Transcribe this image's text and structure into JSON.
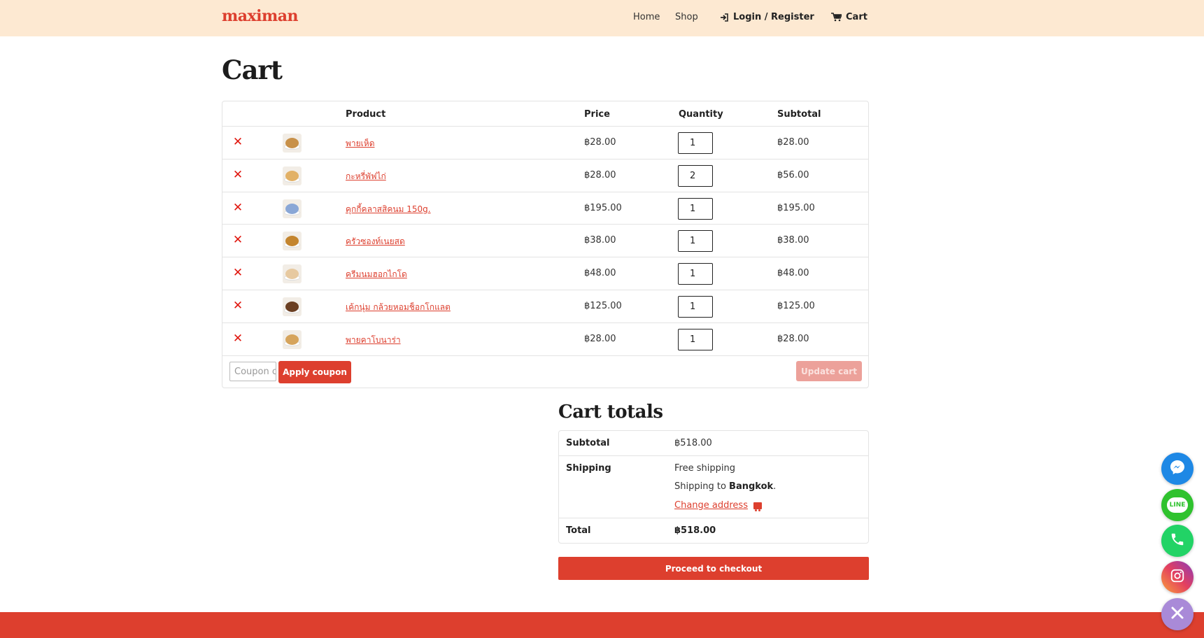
{
  "header": {
    "brand": "maximan",
    "nav": {
      "home": "Home",
      "shop": "Shop",
      "login": "Login / Register",
      "cart": "Cart"
    }
  },
  "page": {
    "title": "Cart"
  },
  "cart_table": {
    "columns": {
      "product": "Product",
      "price": "Price",
      "quantity": "Quantity",
      "subtotal": "Subtotal"
    },
    "rows": [
      {
        "name": "พายเห็ด",
        "price": "฿28.00",
        "quantity": "1",
        "subtotal": "฿28.00",
        "thumb_color": "#c8914a"
      },
      {
        "name": "กะหรี่พัฟไก่",
        "price": "฿28.00",
        "quantity": "2",
        "subtotal": "฿56.00",
        "thumb_color": "#e2b166"
      },
      {
        "name": "คุกกี้คลาสสิคนม 150g.",
        "price": "฿195.00",
        "quantity": "1",
        "subtotal": "฿195.00",
        "thumb_color": "#8aa7d6"
      },
      {
        "name": "ครัวซองท์เนยสด",
        "price": "฿38.00",
        "quantity": "1",
        "subtotal": "฿38.00",
        "thumb_color": "#c4852e"
      },
      {
        "name": "ครีมนมฮอกไกโด",
        "price": "฿48.00",
        "quantity": "1",
        "subtotal": "฿48.00",
        "thumb_color": "#e7c9a0"
      },
      {
        "name": "เค้กนุ่ม กล้วยหอมช็อกโกแลต",
        "price": "฿125.00",
        "quantity": "1",
        "subtotal": "฿125.00",
        "thumb_color": "#6b3f22"
      },
      {
        "name": "พายคาโบนาร่า",
        "price": "฿28.00",
        "quantity": "1",
        "subtotal": "฿28.00",
        "thumb_color": "#d6a45c"
      }
    ],
    "coupon_placeholder": "Coupon code",
    "apply_coupon": "Apply coupon",
    "update_cart": "Update cart"
  },
  "totals": {
    "title": "Cart totals",
    "subtotal_label": "Subtotal",
    "subtotal_value": "฿518.00",
    "shipping_label": "Shipping",
    "shipping_method": "Free shipping",
    "shipping_to_prefix": "Shipping to ",
    "shipping_to_place": "Bangkok",
    "shipping_to_suffix": ".",
    "change_address": "Change address",
    "total_label": "Total",
    "total_value": "฿518.00",
    "checkout": "Proceed to checkout"
  },
  "colors": {
    "accent": "#dd3f2e",
    "header_bg": "#fde9d2",
    "messenger": "#1e88e5",
    "line": "#2fc22e",
    "phone": "#22d366",
    "close_fab": "#a98ad8"
  },
  "floating_buttons": {
    "messenger": "messenger-icon",
    "line": "LINE",
    "phone": "phone-icon",
    "instagram": "instagram-icon",
    "close": "close-icon"
  }
}
